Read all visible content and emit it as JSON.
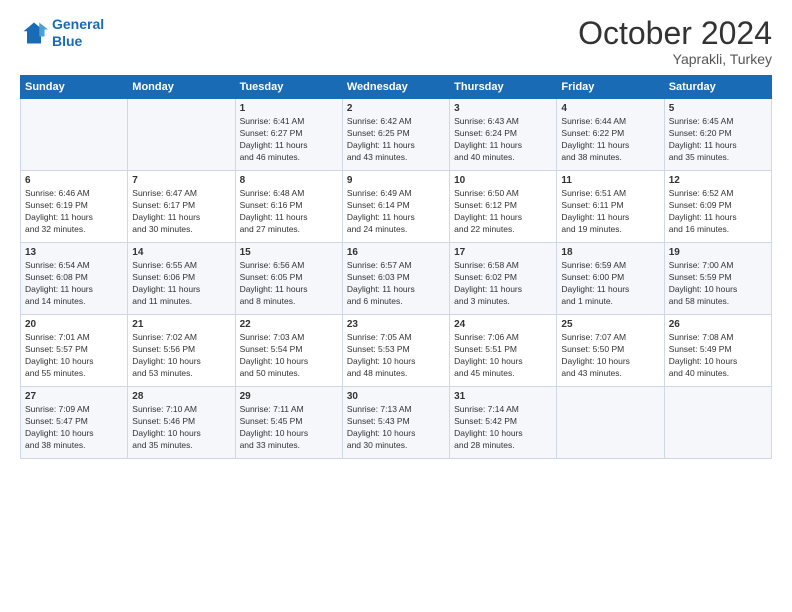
{
  "header": {
    "logo_line1": "General",
    "logo_line2": "Blue",
    "month": "October 2024",
    "location": "Yaprakli, Turkey"
  },
  "weekdays": [
    "Sunday",
    "Monday",
    "Tuesday",
    "Wednesday",
    "Thursday",
    "Friday",
    "Saturday"
  ],
  "rows": [
    [
      {
        "day": "",
        "info": ""
      },
      {
        "day": "",
        "info": ""
      },
      {
        "day": "1",
        "info": "Sunrise: 6:41 AM\nSunset: 6:27 PM\nDaylight: 11 hours\nand 46 minutes."
      },
      {
        "day": "2",
        "info": "Sunrise: 6:42 AM\nSunset: 6:25 PM\nDaylight: 11 hours\nand 43 minutes."
      },
      {
        "day": "3",
        "info": "Sunrise: 6:43 AM\nSunset: 6:24 PM\nDaylight: 11 hours\nand 40 minutes."
      },
      {
        "day": "4",
        "info": "Sunrise: 6:44 AM\nSunset: 6:22 PM\nDaylight: 11 hours\nand 38 minutes."
      },
      {
        "day": "5",
        "info": "Sunrise: 6:45 AM\nSunset: 6:20 PM\nDaylight: 11 hours\nand 35 minutes."
      }
    ],
    [
      {
        "day": "6",
        "info": "Sunrise: 6:46 AM\nSunset: 6:19 PM\nDaylight: 11 hours\nand 32 minutes."
      },
      {
        "day": "7",
        "info": "Sunrise: 6:47 AM\nSunset: 6:17 PM\nDaylight: 11 hours\nand 30 minutes."
      },
      {
        "day": "8",
        "info": "Sunrise: 6:48 AM\nSunset: 6:16 PM\nDaylight: 11 hours\nand 27 minutes."
      },
      {
        "day": "9",
        "info": "Sunrise: 6:49 AM\nSunset: 6:14 PM\nDaylight: 11 hours\nand 24 minutes."
      },
      {
        "day": "10",
        "info": "Sunrise: 6:50 AM\nSunset: 6:12 PM\nDaylight: 11 hours\nand 22 minutes."
      },
      {
        "day": "11",
        "info": "Sunrise: 6:51 AM\nSunset: 6:11 PM\nDaylight: 11 hours\nand 19 minutes."
      },
      {
        "day": "12",
        "info": "Sunrise: 6:52 AM\nSunset: 6:09 PM\nDaylight: 11 hours\nand 16 minutes."
      }
    ],
    [
      {
        "day": "13",
        "info": "Sunrise: 6:54 AM\nSunset: 6:08 PM\nDaylight: 11 hours\nand 14 minutes."
      },
      {
        "day": "14",
        "info": "Sunrise: 6:55 AM\nSunset: 6:06 PM\nDaylight: 11 hours\nand 11 minutes."
      },
      {
        "day": "15",
        "info": "Sunrise: 6:56 AM\nSunset: 6:05 PM\nDaylight: 11 hours\nand 8 minutes."
      },
      {
        "day": "16",
        "info": "Sunrise: 6:57 AM\nSunset: 6:03 PM\nDaylight: 11 hours\nand 6 minutes."
      },
      {
        "day": "17",
        "info": "Sunrise: 6:58 AM\nSunset: 6:02 PM\nDaylight: 11 hours\nand 3 minutes."
      },
      {
        "day": "18",
        "info": "Sunrise: 6:59 AM\nSunset: 6:00 PM\nDaylight: 11 hours\nand 1 minute."
      },
      {
        "day": "19",
        "info": "Sunrise: 7:00 AM\nSunset: 5:59 PM\nDaylight: 10 hours\nand 58 minutes."
      }
    ],
    [
      {
        "day": "20",
        "info": "Sunrise: 7:01 AM\nSunset: 5:57 PM\nDaylight: 10 hours\nand 55 minutes."
      },
      {
        "day": "21",
        "info": "Sunrise: 7:02 AM\nSunset: 5:56 PM\nDaylight: 10 hours\nand 53 minutes."
      },
      {
        "day": "22",
        "info": "Sunrise: 7:03 AM\nSunset: 5:54 PM\nDaylight: 10 hours\nand 50 minutes."
      },
      {
        "day": "23",
        "info": "Sunrise: 7:05 AM\nSunset: 5:53 PM\nDaylight: 10 hours\nand 48 minutes."
      },
      {
        "day": "24",
        "info": "Sunrise: 7:06 AM\nSunset: 5:51 PM\nDaylight: 10 hours\nand 45 minutes."
      },
      {
        "day": "25",
        "info": "Sunrise: 7:07 AM\nSunset: 5:50 PM\nDaylight: 10 hours\nand 43 minutes."
      },
      {
        "day": "26",
        "info": "Sunrise: 7:08 AM\nSunset: 5:49 PM\nDaylight: 10 hours\nand 40 minutes."
      }
    ],
    [
      {
        "day": "27",
        "info": "Sunrise: 7:09 AM\nSunset: 5:47 PM\nDaylight: 10 hours\nand 38 minutes."
      },
      {
        "day": "28",
        "info": "Sunrise: 7:10 AM\nSunset: 5:46 PM\nDaylight: 10 hours\nand 35 minutes."
      },
      {
        "day": "29",
        "info": "Sunrise: 7:11 AM\nSunset: 5:45 PM\nDaylight: 10 hours\nand 33 minutes."
      },
      {
        "day": "30",
        "info": "Sunrise: 7:13 AM\nSunset: 5:43 PM\nDaylight: 10 hours\nand 30 minutes."
      },
      {
        "day": "31",
        "info": "Sunrise: 7:14 AM\nSunset: 5:42 PM\nDaylight: 10 hours\nand 28 minutes."
      },
      {
        "day": "",
        "info": ""
      },
      {
        "day": "",
        "info": ""
      }
    ]
  ]
}
